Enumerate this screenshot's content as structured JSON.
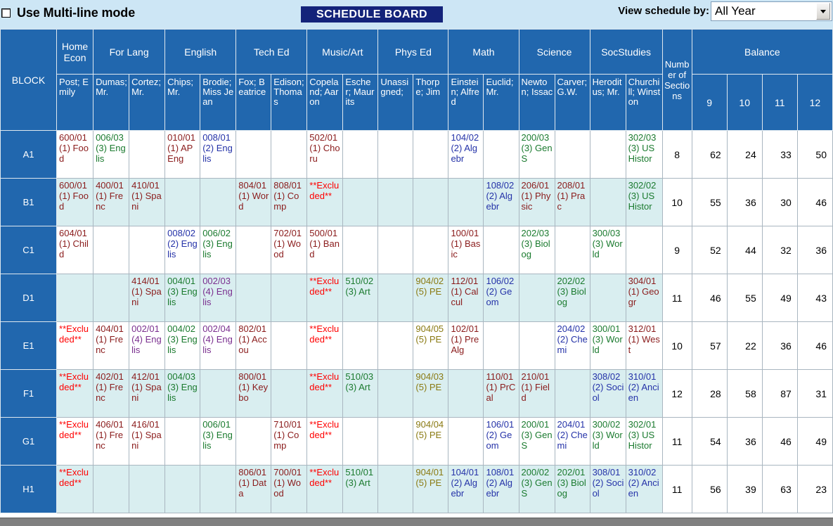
{
  "toolbar": {
    "multiline_label": "Use Multi-line mode",
    "multiline_checked": false,
    "board_title": "SCHEDULE BOARD",
    "view_by_label": "View schedule by:",
    "view_by_value": "All Year"
  },
  "grid": {
    "block_header": "BLOCK",
    "sections_header": "Number of Sections",
    "balance_header": "Balance",
    "balance_grades": [
      "9",
      "10",
      "11",
      "12"
    ],
    "departments": [
      {
        "name": "Home Econ",
        "span": 1
      },
      {
        "name": "For Lang",
        "span": 2
      },
      {
        "name": "English",
        "span": 2
      },
      {
        "name": "Tech Ed",
        "span": 2
      },
      {
        "name": "Music/Art",
        "span": 2
      },
      {
        "name": "Phys Ed",
        "span": 2
      },
      {
        "name": "Math",
        "span": 2
      },
      {
        "name": "Science",
        "span": 2
      },
      {
        "name": "SocStudies",
        "span": 2
      }
    ],
    "teachers": [
      "Post; Emily",
      "Dumas; Mr.",
      "Cortez; Mr.",
      "Chips; Mr.",
      "Brodie; Miss Jean",
      "Fox; Beatrice",
      "Edison; Thomas",
      "Copeland; Aaron",
      "Escher; Maurits",
      "Unassigned;",
      "Thorpe; Jim",
      "Einstein; Alfred",
      "Euclid; Mr.",
      "Newton; Issac",
      "Carver; G.W.",
      "Heroditus; Mr.",
      "Churchill; Winston"
    ],
    "rows": [
      {
        "block": "A1",
        "shaded": false,
        "cells": [
          {
            "text": "600/01 (1) Food",
            "color": "maroon"
          },
          {
            "text": "006/03 (3) Englis",
            "color": "green"
          },
          {
            "text": "",
            "color": "none"
          },
          {
            "text": "010/01 (1) AP Eng",
            "color": "maroon"
          },
          {
            "text": "008/01 (2) Englis",
            "color": "blue"
          },
          {
            "text": "",
            "color": "none"
          },
          {
            "text": "",
            "color": "none"
          },
          {
            "text": "502/01 (1) Choru",
            "color": "maroon"
          },
          {
            "text": "",
            "color": "none"
          },
          {
            "text": "",
            "color": "none"
          },
          {
            "text": "",
            "color": "none"
          },
          {
            "text": "104/02 (2) Algebr",
            "color": "blue"
          },
          {
            "text": "",
            "color": "none"
          },
          {
            "text": "200/03 (3) GenS",
            "color": "green"
          },
          {
            "text": "",
            "color": "none"
          },
          {
            "text": "",
            "color": "none"
          },
          {
            "text": "302/03 (3) US Histor",
            "color": "green"
          }
        ],
        "sections": "8",
        "balance": [
          "62",
          "24",
          "33",
          "50"
        ]
      },
      {
        "block": "B1",
        "shaded": true,
        "cells": [
          {
            "text": "600/01 (1) Food",
            "color": "maroon"
          },
          {
            "text": "400/01 (1) Frenc",
            "color": "maroon"
          },
          {
            "text": "410/01 (1) Spani",
            "color": "maroon"
          },
          {
            "text": "",
            "color": "none"
          },
          {
            "text": "",
            "color": "none"
          },
          {
            "text": "804/01 (1) Word",
            "color": "maroon"
          },
          {
            "text": "808/01 (1) Comp",
            "color": "maroon"
          },
          {
            "text": "**Excluded**",
            "color": "excl"
          },
          {
            "text": "",
            "color": "none"
          },
          {
            "text": "",
            "color": "none"
          },
          {
            "text": "",
            "color": "none"
          },
          {
            "text": "",
            "color": "none"
          },
          {
            "text": "108/02 (2) Algebr",
            "color": "blue"
          },
          {
            "text": "206/01 (1) Physic",
            "color": "maroon"
          },
          {
            "text": "208/01 (1) Prac",
            "color": "maroon"
          },
          {
            "text": "",
            "color": "none"
          },
          {
            "text": "302/02 (3) US Histor",
            "color": "green"
          }
        ],
        "sections": "10",
        "balance": [
          "55",
          "36",
          "30",
          "46"
        ]
      },
      {
        "block": "C1",
        "shaded": false,
        "cells": [
          {
            "text": "604/01 (1) Child",
            "color": "maroon"
          },
          {
            "text": "",
            "color": "none"
          },
          {
            "text": "",
            "color": "none"
          },
          {
            "text": "008/02 (2) Englis",
            "color": "blue"
          },
          {
            "text": "006/02 (3) Englis",
            "color": "green"
          },
          {
            "text": "",
            "color": "none"
          },
          {
            "text": "702/01 (1) Wood",
            "color": "maroon"
          },
          {
            "text": "500/01 (1) Band",
            "color": "maroon"
          },
          {
            "text": "",
            "color": "none"
          },
          {
            "text": "",
            "color": "none"
          },
          {
            "text": "",
            "color": "none"
          },
          {
            "text": "100/01 (1) Basic",
            "color": "maroon"
          },
          {
            "text": "",
            "color": "none"
          },
          {
            "text": "202/03 (3) Biolog",
            "color": "green"
          },
          {
            "text": "",
            "color": "none"
          },
          {
            "text": "300/03 (3) World",
            "color": "green"
          },
          {
            "text": "",
            "color": "none"
          }
        ],
        "sections": "9",
        "balance": [
          "52",
          "44",
          "32",
          "36"
        ]
      },
      {
        "block": "D1",
        "shaded": true,
        "cells": [
          {
            "text": "",
            "color": "none"
          },
          {
            "text": "",
            "color": "none"
          },
          {
            "text": "414/01 (1) Spani",
            "color": "maroon"
          },
          {
            "text": "004/01 (3) Englis",
            "color": "green"
          },
          {
            "text": "002/03 (4) Englis",
            "color": "purple"
          },
          {
            "text": "",
            "color": "none"
          },
          {
            "text": "",
            "color": "none"
          },
          {
            "text": "**Excluded**",
            "color": "excl"
          },
          {
            "text": "510/02 (3) Art",
            "color": "green"
          },
          {
            "text": "",
            "color": "none"
          },
          {
            "text": "904/02 (5) PE",
            "color": "olive"
          },
          {
            "text": "112/01 (1) Calcul",
            "color": "maroon"
          },
          {
            "text": "106/02 (2) Geom",
            "color": "blue"
          },
          {
            "text": "",
            "color": "none"
          },
          {
            "text": "202/02 (3) Biolog",
            "color": "green"
          },
          {
            "text": "",
            "color": "none"
          },
          {
            "text": "304/01 (1) Geogr",
            "color": "maroon"
          }
        ],
        "sections": "11",
        "balance": [
          "46",
          "55",
          "49",
          "43"
        ]
      },
      {
        "block": "E1",
        "shaded": false,
        "cells": [
          {
            "text": "**Excluded**",
            "color": "excl"
          },
          {
            "text": "404/01 (1) Frenc",
            "color": "maroon"
          },
          {
            "text": "002/01 (4) Englis",
            "color": "purple"
          },
          {
            "text": "004/02 (3) Englis",
            "color": "green"
          },
          {
            "text": "002/04 (4) Englis",
            "color": "purple"
          },
          {
            "text": "802/01 (1) Accou",
            "color": "maroon"
          },
          {
            "text": "",
            "color": "none"
          },
          {
            "text": "**Excluded**",
            "color": "excl"
          },
          {
            "text": "",
            "color": "none"
          },
          {
            "text": "",
            "color": "none"
          },
          {
            "text": "904/05 (5) PE",
            "color": "olive"
          },
          {
            "text": "102/01 (1) PreAlg",
            "color": "maroon"
          },
          {
            "text": "",
            "color": "none"
          },
          {
            "text": "",
            "color": "none"
          },
          {
            "text": "204/02 (2) Chemi",
            "color": "blue"
          },
          {
            "text": "300/01 (3) World",
            "color": "green"
          },
          {
            "text": "312/01 (1) West",
            "color": "maroon"
          }
        ],
        "sections": "10",
        "balance": [
          "57",
          "22",
          "36",
          "46"
        ]
      },
      {
        "block": "F1",
        "shaded": true,
        "cells": [
          {
            "text": "**Excluded**",
            "color": "excl"
          },
          {
            "text": "402/01 (1) Frenc",
            "color": "maroon"
          },
          {
            "text": "412/01 (1) Spani",
            "color": "maroon"
          },
          {
            "text": "004/03 (3) Englis",
            "color": "green"
          },
          {
            "text": "",
            "color": "none"
          },
          {
            "text": "800/01 (1) Keybo",
            "color": "maroon"
          },
          {
            "text": "",
            "color": "none"
          },
          {
            "text": "**Excluded**",
            "color": "excl"
          },
          {
            "text": "510/03 (3) Art",
            "color": "green"
          },
          {
            "text": "",
            "color": "none"
          },
          {
            "text": "904/03 (5) PE",
            "color": "olive"
          },
          {
            "text": "",
            "color": "none"
          },
          {
            "text": "110/01 (1) PrCal",
            "color": "maroon"
          },
          {
            "text": "210/01 (1) Field",
            "color": "maroon"
          },
          {
            "text": "",
            "color": "none"
          },
          {
            "text": "308/02 (2) Sociol",
            "color": "blue"
          },
          {
            "text": "310/01 (2) Ancien",
            "color": "blue"
          }
        ],
        "sections": "12",
        "balance": [
          "28",
          "58",
          "87",
          "31"
        ]
      },
      {
        "block": "G1",
        "shaded": false,
        "cells": [
          {
            "text": "**Excluded**",
            "color": "excl"
          },
          {
            "text": "406/01 (1) Frenc",
            "color": "maroon"
          },
          {
            "text": "416/01 (1) Spani",
            "color": "maroon"
          },
          {
            "text": "",
            "color": "none"
          },
          {
            "text": "006/01 (3) Englis",
            "color": "green"
          },
          {
            "text": "",
            "color": "none"
          },
          {
            "text": "710/01 (1) Comp",
            "color": "maroon"
          },
          {
            "text": "**Excluded**",
            "color": "excl"
          },
          {
            "text": "",
            "color": "none"
          },
          {
            "text": "",
            "color": "none"
          },
          {
            "text": "904/04 (5) PE",
            "color": "olive"
          },
          {
            "text": "",
            "color": "none"
          },
          {
            "text": "106/01 (2) Geom",
            "color": "blue"
          },
          {
            "text": "200/01 (3) GenS",
            "color": "green"
          },
          {
            "text": "204/01 (2) Chemi",
            "color": "blue"
          },
          {
            "text": "300/02 (3) World",
            "color": "green"
          },
          {
            "text": "302/01 (3) US Histor",
            "color": "green"
          }
        ],
        "sections": "11",
        "balance": [
          "54",
          "36",
          "46",
          "49"
        ]
      },
      {
        "block": "H1",
        "shaded": true,
        "cells": [
          {
            "text": "**Excluded**",
            "color": "excl"
          },
          {
            "text": "",
            "color": "none"
          },
          {
            "text": "",
            "color": "none"
          },
          {
            "text": "",
            "color": "none"
          },
          {
            "text": "",
            "color": "none"
          },
          {
            "text": "806/01 (1) Data",
            "color": "maroon"
          },
          {
            "text": "700/01 (1) Wood",
            "color": "maroon"
          },
          {
            "text": "**Excluded**",
            "color": "excl"
          },
          {
            "text": "510/01 (3) Art",
            "color": "green"
          },
          {
            "text": "",
            "color": "none"
          },
          {
            "text": "904/01 (5) PE",
            "color": "olive"
          },
          {
            "text": "104/01 (2) Algebr",
            "color": "blue"
          },
          {
            "text": "108/01 (2) Algebr",
            "color": "blue"
          },
          {
            "text": "200/02 (3) GenS",
            "color": "green"
          },
          {
            "text": "202/01 (3) Biolog",
            "color": "green"
          },
          {
            "text": "308/01 (2) Sociol",
            "color": "blue"
          },
          {
            "text": "310/02 (2) Ancien",
            "color": "blue"
          }
        ],
        "sections": "11",
        "balance": [
          "56",
          "39",
          "63",
          "23"
        ]
      }
    ]
  },
  "colors": {
    "header_blue": "#2167ae",
    "title_navy": "#14237a",
    "page_bg": "#cde6f5",
    "row_shade": "#d9eef0",
    "maroon": "#8a1b1b",
    "green": "#1a7a2e",
    "blue": "#2432a8",
    "purple": "#7a2f8f",
    "olive": "#8a7a12",
    "excluded_red": "#ff0000"
  }
}
